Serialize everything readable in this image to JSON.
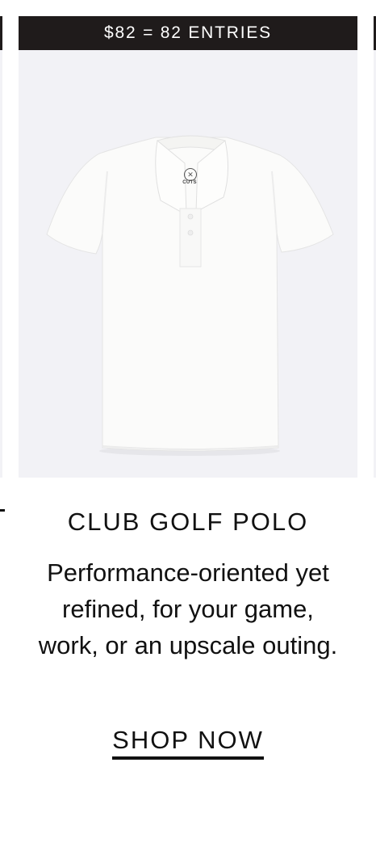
{
  "promo": {
    "banner_text": "$82 = 82 ENTRIES"
  },
  "product": {
    "image_alt": "white polo shirt",
    "brand_tag": "CUTS",
    "title": "CLUB GOLF POLO",
    "description": "Performance-oriented yet refined, for your game, work, or an upscale outing.",
    "cta_label": "SHOP NOW"
  },
  "colors": {
    "banner_bg": "#1f1b1b",
    "image_bg": "#f2f2f6",
    "text": "#111111"
  }
}
